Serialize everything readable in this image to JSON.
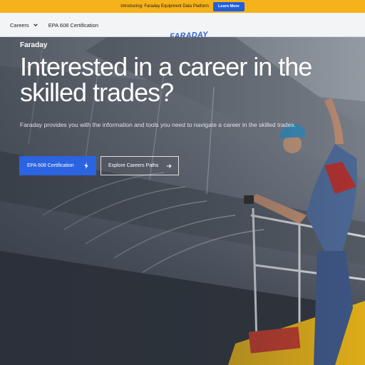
{
  "announcement": {
    "text": "Introducing: Faraday Equipment Data Platform",
    "button_label": "Learn More",
    "bg_color": "#f6b21a",
    "button_color": "#1f5fe0"
  },
  "nav": {
    "items": [
      {
        "label": "Careers",
        "icon": "chevron-down-icon"
      },
      {
        "label": "EPA 608 Certification"
      }
    ],
    "logo_text": "FARADAY"
  },
  "hero": {
    "eyebrow": "Faraday",
    "headline": "Interested in a career in the skilled trades?",
    "subtitle": "Faraday provides you with the information and tools you need to navigate a career in the skilled trades.",
    "primary_button": {
      "label": "EPA 608 Certification",
      "icon": "bolt-icon"
    },
    "secondary_button": {
      "label": "Explore Careers Paths",
      "icon": "arrow-right-icon"
    },
    "accent_color": "#2b63e0"
  }
}
